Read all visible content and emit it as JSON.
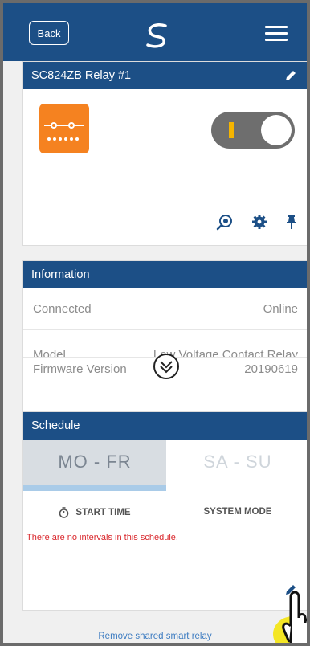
{
  "topbar": {
    "back_label": "Back"
  },
  "device": {
    "title": "SC824ZB Relay #1"
  },
  "information": {
    "header": "Information",
    "rows": [
      {
        "label": "Connected",
        "value": "Online"
      },
      {
        "label": "Model",
        "value": "Low Voltage Contact Relay"
      },
      {
        "label": "Firmware Version",
        "value": "20190619"
      }
    ]
  },
  "schedule": {
    "header": "Schedule",
    "tabs": [
      "MO - FR",
      "SA - SU"
    ],
    "columns": {
      "start_time": "START TIME",
      "system_mode": "SYSTEM MODE"
    },
    "empty_message": "There are no intervals in this schedule."
  },
  "footer": {
    "remove_label": "Remove shared smart relay"
  },
  "colors": {
    "header_blue": "#1c4f86",
    "relay_orange": "#f58220",
    "toggle_on": "#f5b400",
    "error_red": "#d9262b",
    "link_blue": "#3d7cc1"
  }
}
